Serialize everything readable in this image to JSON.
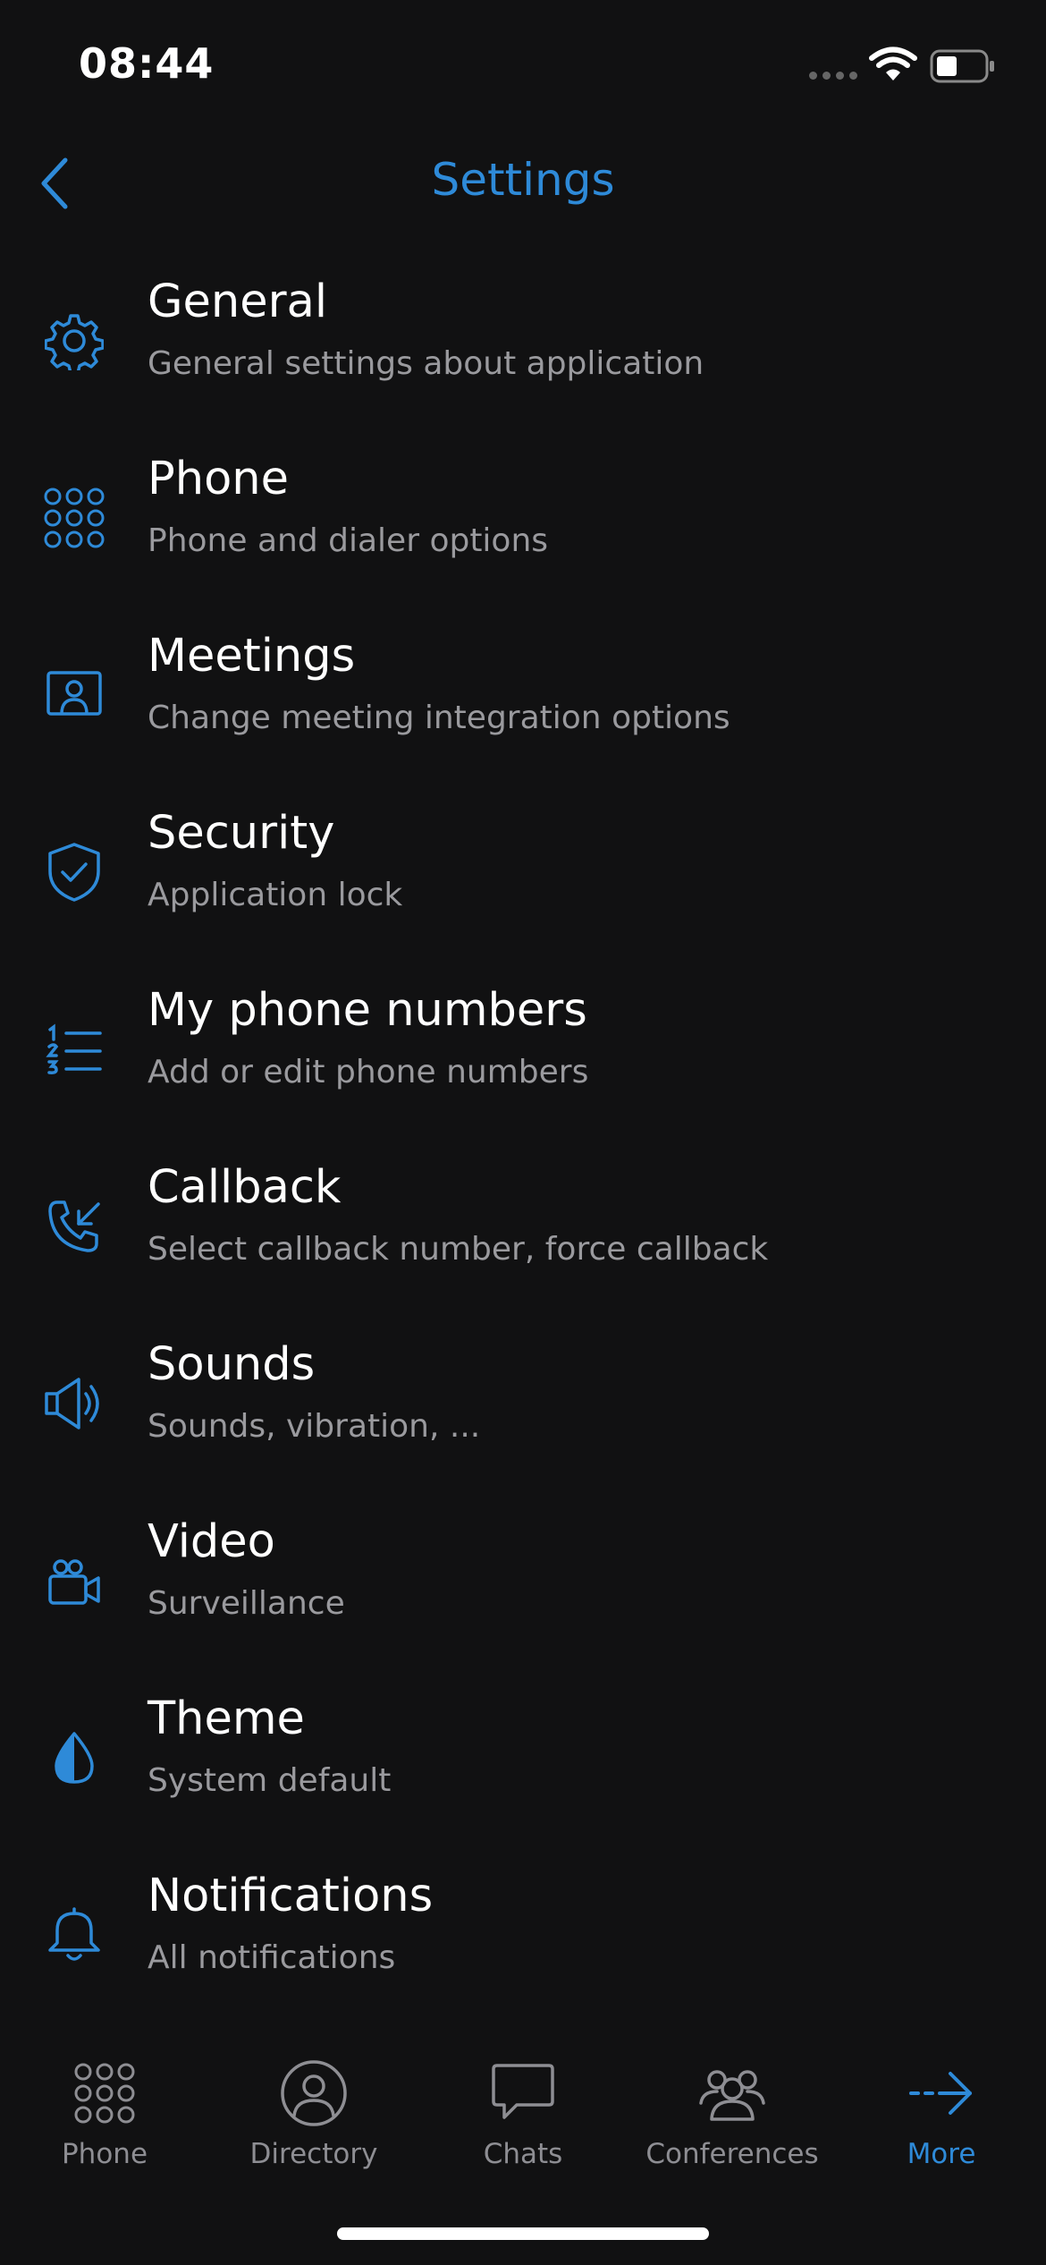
{
  "status_bar": {
    "time": "08:44"
  },
  "nav": {
    "back_icon": "chevron-left-icon",
    "title": "Settings"
  },
  "settings": [
    {
      "icon": "gear-icon",
      "title": "General",
      "subtitle": "General settings about application"
    },
    {
      "icon": "dialpad-icon",
      "title": "Phone",
      "subtitle": "Phone and dialer options"
    },
    {
      "icon": "meeting-icon",
      "title": "Meetings",
      "subtitle": "Change meeting integration options"
    },
    {
      "icon": "shield-check-icon",
      "title": "Security",
      "subtitle": "Application lock"
    },
    {
      "icon": "numbered-list-icon",
      "title": "My phone numbers",
      "subtitle": "Add or edit phone numbers"
    },
    {
      "icon": "callback-icon",
      "title": "Callback",
      "subtitle": "Select callback number, force callback"
    },
    {
      "icon": "speaker-icon",
      "title": "Sounds",
      "subtitle": "Sounds, vibration, ..."
    },
    {
      "icon": "video-camera-icon",
      "title": "Video",
      "subtitle": "Surveillance"
    },
    {
      "icon": "theme-drop-icon",
      "title": "Theme",
      "subtitle": "System default"
    },
    {
      "icon": "bell-icon",
      "title": "Notifications",
      "subtitle": "All notifications"
    }
  ],
  "tab_bar": {
    "active": "More",
    "tabs": [
      {
        "icon": "dialpad-icon",
        "label": "Phone"
      },
      {
        "icon": "person-icon",
        "label": "Directory"
      },
      {
        "icon": "chat-bubble-icon",
        "label": "Chats"
      },
      {
        "icon": "group-icon",
        "label": "Conferences"
      },
      {
        "icon": "arrow-right-icon",
        "label": "More"
      }
    ]
  },
  "colors": {
    "background": "#111112",
    "accent": "#2e8ad8",
    "text_primary": "#ffffff",
    "text_secondary": "#9a9a9e",
    "tab_inactive": "#8e8e93"
  }
}
